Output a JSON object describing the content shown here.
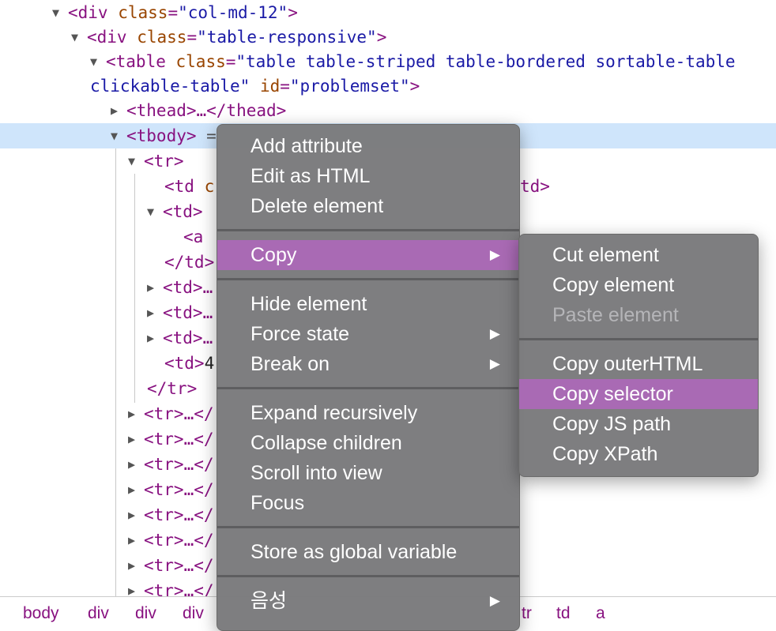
{
  "dom_tree": {
    "line1": {
      "tag_open": "<div",
      "attr": "class",
      "eq": "=",
      "value": "\"col-md-12\"",
      "close": ">"
    },
    "line2": {
      "tag_open": "<div",
      "attr": "class",
      "eq": "=",
      "value": "\"table-responsive\"",
      "close": ">"
    },
    "line3": {
      "tag_open": "<table",
      "attr": "class",
      "eq": "=",
      "value": "\"table table-striped table-bordered sortable-table"
    },
    "line4": {
      "value": "clickable-table\"",
      "attr": "id",
      "eq": "=",
      "id_value": "\"problemset\"",
      "close": ">"
    },
    "line5": {
      "text": "<thead>…</thead>"
    },
    "line6": {
      "text": "<tbody>",
      "rest": "="
    },
    "line7": {
      "text": "<tr>"
    },
    "line8": {
      "text": "<td",
      "partial": "c",
      "tail": "td>"
    },
    "line9": {
      "text": "<td>"
    },
    "line10": {
      "text": "<a"
    },
    "line11": {
      "text": "</td>"
    },
    "line12": {
      "text": "<td>…"
    },
    "line13": {
      "text": "<td>…"
    },
    "line14": {
      "text": "<td>…"
    },
    "line15": {
      "text": "<td>",
      "partial": "4"
    },
    "line16": {
      "text": "</tr>"
    },
    "tr_rows": [
      "<tr>…</",
      "<tr>…</",
      "<tr>…</",
      "<tr>…</",
      "<tr>…</",
      "<tr>…</",
      "<tr>…</",
      "<tr>…</"
    ],
    "expand_triangle": "▶",
    "collapse_triangle": "▼"
  },
  "breadcrumbs": [
    "body",
    "div",
    "div",
    "div",
    "tr",
    "td",
    "a"
  ],
  "context_menu": {
    "items": [
      {
        "label": "Add attribute"
      },
      {
        "label": "Edit as HTML"
      },
      {
        "label": "Delete element"
      },
      {
        "label": "Copy",
        "highlighted": true,
        "submenu": true
      },
      {
        "label": "Hide element"
      },
      {
        "label": "Force state",
        "submenu": true
      },
      {
        "label": "Break on",
        "submenu": true
      },
      {
        "label": "Expand recursively"
      },
      {
        "label": "Collapse children"
      },
      {
        "label": "Scroll into view"
      },
      {
        "label": "Focus"
      },
      {
        "label": "Store as global variable"
      },
      {
        "label": "음성",
        "submenu": true
      }
    ],
    "submenu_arrow": "▶",
    "highlight_color": "#a96ab4"
  },
  "copy_submenu": {
    "items": [
      {
        "label": "Cut element"
      },
      {
        "label": "Copy element"
      },
      {
        "label": "Paste element",
        "disabled": true
      },
      {
        "label": "Copy outerHTML"
      },
      {
        "label": "Copy selector",
        "highlighted": true
      },
      {
        "label": "Copy JS path"
      },
      {
        "label": "Copy XPath"
      }
    ]
  },
  "colors": {
    "tag": "#881280",
    "attr_name": "#994500",
    "attr_value": "#1a1aa6",
    "selection": "#cfe5fb"
  }
}
